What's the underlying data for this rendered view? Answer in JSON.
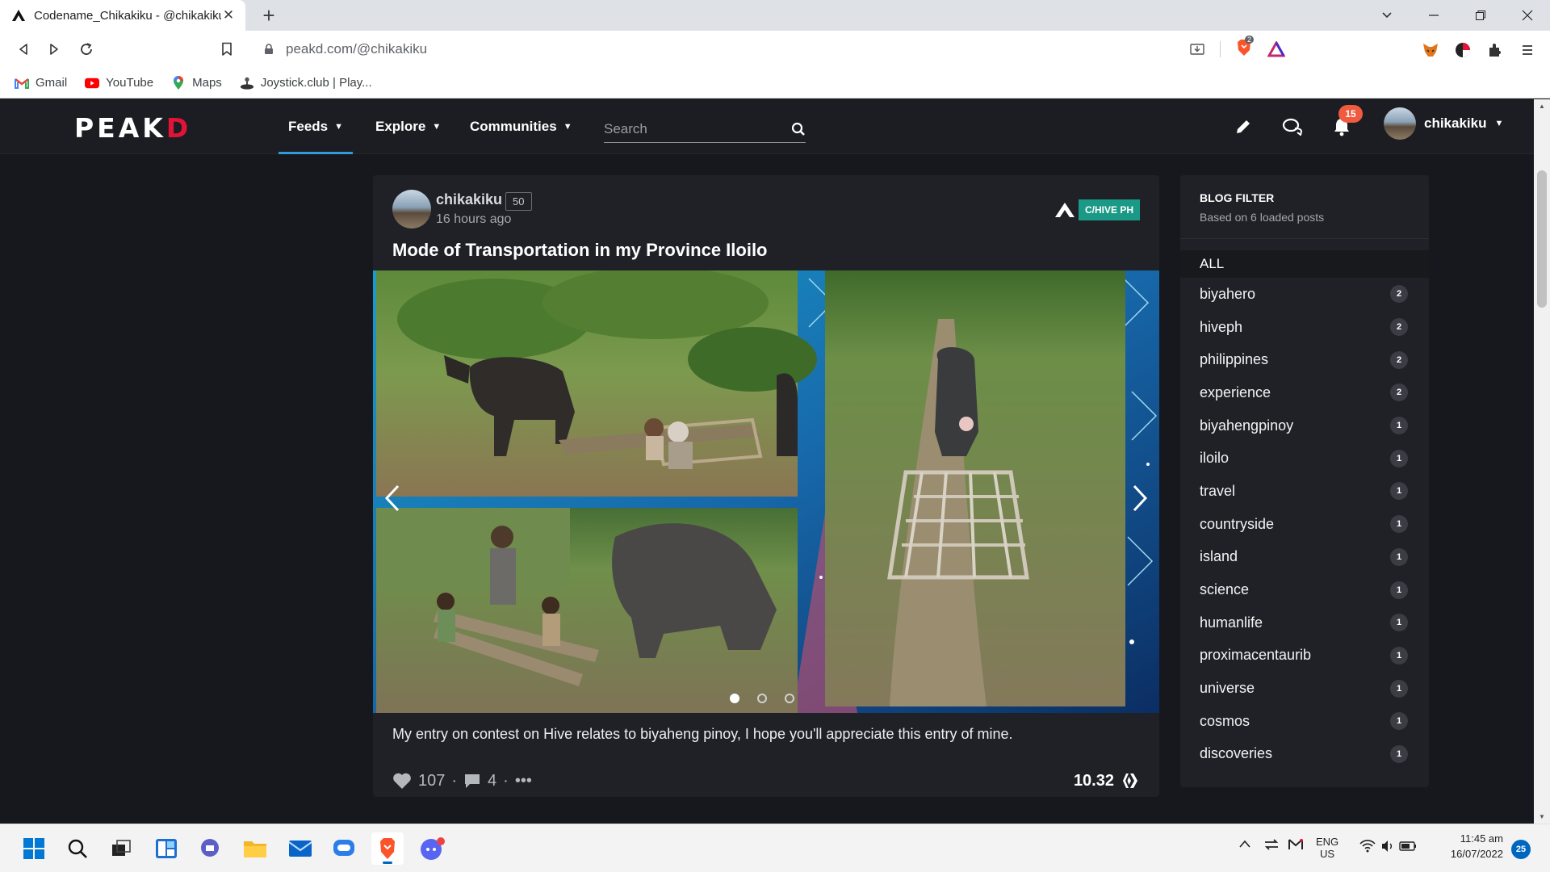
{
  "browser": {
    "tab_title": "Codename_Chikakiku - @chikakiku",
    "new_tab": "+",
    "url": "peakd.com/@chikakiku",
    "brave_shield_count": "2",
    "bookmarks": [
      {
        "label": "Gmail",
        "icon": "gmail-icon"
      },
      {
        "label": "YouTube",
        "icon": "youtube-icon"
      },
      {
        "label": "Maps",
        "icon": "maps-icon"
      },
      {
        "label": "Joystick.club | Play...",
        "icon": "joystick-icon"
      }
    ]
  },
  "site": {
    "logo_a": "PE",
    "logo_b": "A",
    "logo_c": "K",
    "logo_d": "D",
    "nav": [
      {
        "label": "Feeds",
        "active": true
      },
      {
        "label": "Explore",
        "active": false
      },
      {
        "label": "Communities",
        "active": false
      }
    ],
    "search_placeholder": "Search",
    "notifications_count": "15",
    "username": "chikakiku"
  },
  "post": {
    "author": "chikakiku",
    "reputation": "50",
    "time_ago": "16 hours ago",
    "community": "C/HIVE PH",
    "title": "Mode of Transportation in my Province Iloilo",
    "description": "My entry on contest on Hive relates to biyaheng pinoy, I hope you'll appreciate this entry of mine.",
    "votes": "107",
    "comments": "4",
    "more": "•••",
    "payout": "10.32",
    "carousel_slides": 3,
    "carousel_active": 0
  },
  "blog_filter": {
    "title": "BLOG FILTER",
    "subtitle": "Based on 6 loaded posts",
    "all_label": "ALL",
    "tags": [
      {
        "name": "biyahero",
        "count": "2"
      },
      {
        "name": "hiveph",
        "count": "2"
      },
      {
        "name": "philippines",
        "count": "2"
      },
      {
        "name": "experience",
        "count": "2"
      },
      {
        "name": "biyahengpinoy",
        "count": "1"
      },
      {
        "name": "iloilo",
        "count": "1"
      },
      {
        "name": "travel",
        "count": "1"
      },
      {
        "name": "countryside",
        "count": "1"
      },
      {
        "name": "island",
        "count": "1"
      },
      {
        "name": "science",
        "count": "1"
      },
      {
        "name": "humanlife",
        "count": "1"
      },
      {
        "name": "proximacentaurib",
        "count": "1"
      },
      {
        "name": "universe",
        "count": "1"
      },
      {
        "name": "cosmos",
        "count": "1"
      },
      {
        "name": "discoveries",
        "count": "1"
      }
    ]
  },
  "taskbar": {
    "lang_top": "ENG",
    "lang_bottom": "US",
    "time": "11:45 am",
    "date": "16/07/2022",
    "notification_count": "25"
  },
  "colors": {
    "page_bg": "#16181d",
    "card_bg": "#1f2126",
    "peakd_red": "#e31337",
    "community_tag": "#1a9a86",
    "badge": "#f05a3f",
    "active_nav": "#2f9bd8"
  }
}
